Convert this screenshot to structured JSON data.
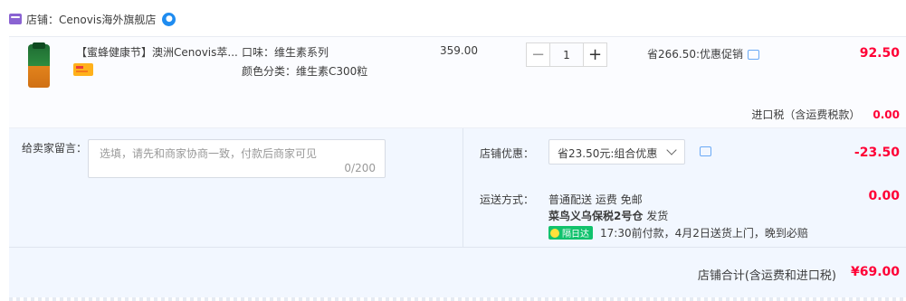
{
  "store": {
    "label": "店铺：Cenovis海外旗舰店"
  },
  "item": {
    "title": "【蜜蜂健康节】澳洲Cenovis萃...",
    "spec1": "口味：维生素系列",
    "spec2": "颜色分类：维生素C300粒",
    "price": "359.00",
    "quantity": "1",
    "qty_minus": "−",
    "qty_plus": "+",
    "discount": "省266.50:优惠促销",
    "subtotal": "92.50"
  },
  "tax": {
    "label": "进口税（含运费税款）",
    "value": "0.00"
  },
  "message": {
    "label": "给卖家留言：",
    "placeholder": "选填，请先和商家协商一致，付款后商家可见",
    "count": "0/200"
  },
  "store_discount": {
    "label": "店铺优惠：",
    "selected": "省23.50元:组合优惠",
    "value": "-23.50"
  },
  "shipping": {
    "label": "运送方式：",
    "line1": "普通配送 运费 免邮",
    "warehouse": "菜鸟义乌保税2号仓",
    "dispatch": "发货",
    "badge": "隔日达",
    "note": "17:30前付款，4月2日送货上门，晚到必赔",
    "value": "0.00"
  },
  "total": {
    "label": "店铺合计(含运费和进口税)",
    "value": "¥69.00"
  }
}
